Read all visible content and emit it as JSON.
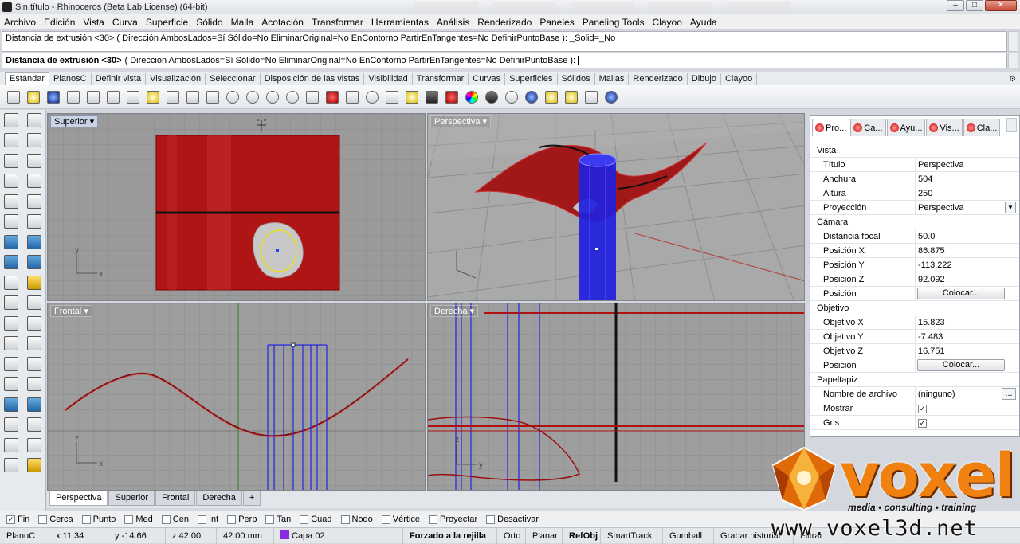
{
  "window": {
    "title": "Sin título - Rhinoceros (Beta Lab License) (64-bit)",
    "controls": {
      "minimize": "–",
      "maximize": "□",
      "close": "✕"
    }
  },
  "menu": [
    "Archivo",
    "Edición",
    "Vista",
    "Curva",
    "Superficie",
    "Sólido",
    "Malla",
    "Acotación",
    "Transformar",
    "Herramientas",
    "Análisis",
    "Renderizado",
    "Paneles",
    "Paneling Tools",
    "Clayoo",
    "Ayuda"
  ],
  "command": {
    "history": "Distancia de extrusión <30> ( Dirección  AmbosLados=Sí  Sólido=No  EliminarOriginal=No  EnContorno  PartirEnTangentes=No  DefinirPuntoBase ): _Solid=_No",
    "prompt_bold": "Distancia de extrusión <30>",
    "prompt_rest": "( Dirección  AmbosLados=Sí  Sólido=No  EliminarOriginal=No  EnContorno  PartirEnTangentes=No  DefinirPuntoBase ):"
  },
  "toolbar_tabs": [
    "Estándar",
    "PlanosC",
    "Definir vista",
    "Visualización",
    "Seleccionar",
    "Disposición de las vistas",
    "Visibilidad",
    "Transformar",
    "Curvas",
    "Superficies",
    "Sólidos",
    "Mallas",
    "Renderizado",
    "Dibujo",
    "Clayoo"
  ],
  "viewports": {
    "top": {
      "label": "Superior"
    },
    "perspective": {
      "label": "Perspectiva"
    },
    "front": {
      "label": "Frontal"
    },
    "right": {
      "label": "Derecha"
    },
    "axis_x": "x",
    "axis_y": "y",
    "axis_z": "z"
  },
  "viewport_tabs": [
    "Perspectiva",
    "Superior",
    "Frontal",
    "Derecha",
    "+"
  ],
  "panel": {
    "tabs": [
      "Pro...",
      "Ca...",
      "Ayu...",
      "Vis...",
      "Cla..."
    ],
    "sections": {
      "vista": "Vista",
      "camara": "Cámara",
      "objetivo": "Objetivo",
      "papeltapiz": "Papeltapiz"
    },
    "vista_rows": [
      {
        "k": "Título",
        "v": "Perspectiva"
      },
      {
        "k": "Anchura",
        "v": "504"
      },
      {
        "k": "Altura",
        "v": "250"
      },
      {
        "k": "Proyección",
        "v": "Perspectiva"
      }
    ],
    "camara_rows": [
      {
        "k": "Distancia focal",
        "v": "50.0"
      },
      {
        "k": "Posición X",
        "v": "86.875"
      },
      {
        "k": "Posición Y",
        "v": "-113.222"
      },
      {
        "k": "Posición Z",
        "v": "92.092"
      },
      {
        "k": "Posición",
        "v": "Colocar..."
      }
    ],
    "objetivo_rows": [
      {
        "k": "Objetivo X",
        "v": "15.823"
      },
      {
        "k": "Objetivo Y",
        "v": "-7.483"
      },
      {
        "k": "Objetivo Z",
        "v": "16.751"
      },
      {
        "k": "Posición",
        "v": "Colocar..."
      }
    ],
    "papel_rows": [
      {
        "k": "Nombre de archivo",
        "v": "(ninguno)"
      },
      {
        "k": "Mostrar",
        "v": "✓"
      },
      {
        "k": "Gris",
        "v": "✓"
      }
    ],
    "ellipsis": "..."
  },
  "snaps": [
    {
      "label": "Fin",
      "checked": true
    },
    {
      "label": "Cerca",
      "checked": false
    },
    {
      "label": "Punto",
      "checked": false
    },
    {
      "label": "Med",
      "checked": false
    },
    {
      "label": "Cen",
      "checked": false
    },
    {
      "label": "Int",
      "checked": false
    },
    {
      "label": "Perp",
      "checked": false
    },
    {
      "label": "Tan",
      "checked": false
    },
    {
      "label": "Cuad",
      "checked": false
    },
    {
      "label": "Nodo",
      "checked": false
    },
    {
      "label": "Vértice",
      "checked": false
    },
    {
      "label": "Proyectar",
      "checked": false
    },
    {
      "label": "Desactivar",
      "checked": false
    }
  ],
  "status": {
    "plane": "PlanoC",
    "x": "x 11.34",
    "y": "y -14.66",
    "z": "z 42.00",
    "units": "42.00 mm",
    "layer": "Capa 02",
    "layer_color": "#8a2be2",
    "grid_snap": "Forzado a la rejilla",
    "ortho": "Orto",
    "planar": "Planar",
    "osnap": "RefObj",
    "smarttrack": "SmartTrack",
    "gumball": "Gumball",
    "history": "Grabar historial",
    "filter": "Filtrar"
  },
  "watermark": {
    "brand": "voxel",
    "tagline": "media • consulting • training",
    "url": "www.voxel3d.net"
  }
}
